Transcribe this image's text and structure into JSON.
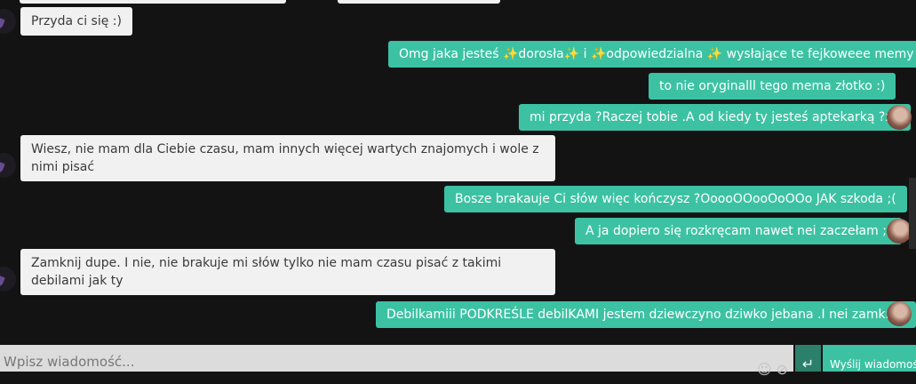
{
  "messages": [
    {
      "side": "in",
      "text": "Przyda ci się :)"
    },
    {
      "side": "out",
      "text": "Omg jaka jesteś ✨dorosła✨ i ✨odpowiedzialna ✨ wysłające te fejkoweee memy"
    },
    {
      "side": "out",
      "text": "to nie oryginalll tego mema złotko :)"
    },
    {
      "side": "out",
      "text": "mi przyda ?Raczej tobie .A od kiedy ty jesteś aptekarką ?xd"
    },
    {
      "side": "in",
      "text": "Wiesz, nie mam dla Ciebie czasu, mam innych więcej wartych znajomych i wole z nimi pisać"
    },
    {
      "side": "out",
      "text": "Bosze brakauje Ci słów więc kończysz ?OoooOOooOoOOo JAK szkoda ;("
    },
    {
      "side": "out",
      "text": "A ja dopiero się rozkręcam nawet nei zaczełam ;("
    },
    {
      "side": "in",
      "text": "Zamknij dupe. I nie, nie brakuje mi słów tylko nie mam czasu pisać z takimi debilami jak ty"
    },
    {
      "side": "out",
      "text": "Debilkamiii PODKREŚLE debilKAMI jestem dziewczyno dziwko jebana .I nei zamknę."
    }
  ],
  "composer": {
    "placeholder": "Wpisz wiadomość...",
    "enter_icon": "↵",
    "send_label": "Wyślij wiadomość"
  },
  "icons": [
    "emoji-icon",
    "attach-icon",
    "enter-icon"
  ],
  "colors": {
    "background": "#141314",
    "incoming": "#f2f1f2",
    "outgoing": "#3cc2a3",
    "send_dark": "#2c7f6a"
  }
}
